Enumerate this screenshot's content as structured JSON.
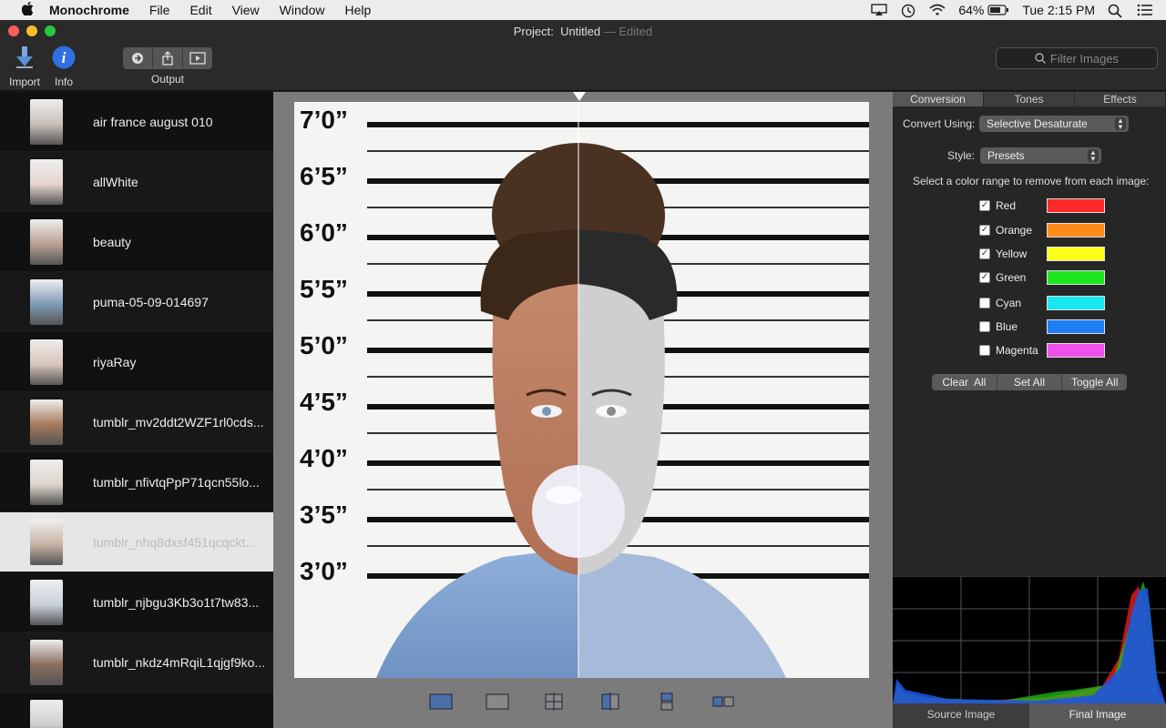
{
  "menubar": {
    "app_name": "Monochrome",
    "items": [
      "File",
      "Edit",
      "View",
      "Window",
      "Help"
    ],
    "battery": "64%",
    "clock": "Tue 2:15 PM"
  },
  "window": {
    "title_prefix": "Project:",
    "title_name": "Untitled",
    "title_suffix": "— Edited"
  },
  "toolbar": {
    "import_label": "Import",
    "info_label": "Info",
    "output_label": "Output",
    "filter_placeholder": "Filter Images"
  },
  "images": [
    {
      "name": "air france august 010",
      "thumb": "#c9bfb8"
    },
    {
      "name": "allWhite",
      "thumb": "#e6d3cf"
    },
    {
      "name": "beauty",
      "thumb": "#b89f90"
    },
    {
      "name": "puma-05-09-014697",
      "thumb": "#7e9bb8"
    },
    {
      "name": "riyaRay",
      "thumb": "#d8c5b8"
    },
    {
      "name": "tumblr_mv2ddt2WZF1rl0cds...",
      "thumb": "#a87a5a"
    },
    {
      "name": "tumblr_nfivtqPpP71qcn55lo...",
      "thumb": "#ddd5cc"
    },
    {
      "name": "tumblr_nhq8dxsf451qcqckt...",
      "thumb": "#c7b3a4"
    },
    {
      "name": "tumblr_njbgu3Kb3o1t7tw83...",
      "thumb": "#c9d0da"
    },
    {
      "name": "tumblr_nkdz4mRqiL1qjgf9ko...",
      "thumb": "#8b6f5e"
    },
    {
      "name": "",
      "thumb": "#cfcfcf"
    }
  ],
  "selected_index": 7,
  "photo": {
    "height_marks": [
      "7’0”",
      "6’5”",
      "6’0”",
      "5’5”",
      "5’0”",
      "4’5”",
      "4’0”",
      "3’5”",
      "3’0”"
    ]
  },
  "inspector": {
    "tabs": [
      "Conversion",
      "Tones",
      "Effects"
    ],
    "active_tab": "Conversion",
    "convert_using_label": "Convert Using:",
    "convert_using_value": "Selective Desaturate",
    "style_label": "Style:",
    "style_value": "Presets",
    "instruction": "Select a color range to remove from each image:",
    "colors": [
      {
        "label": "Red",
        "checked": true,
        "hex": "#ff2a2a"
      },
      {
        "label": "Orange",
        "checked": true,
        "hex": "#ff8c1a"
      },
      {
        "label": "Yellow",
        "checked": true,
        "hex": "#ffff1a"
      },
      {
        "label": "Green",
        "checked": true,
        "hex": "#1ee61e"
      },
      {
        "label": "Cyan",
        "checked": false,
        "hex": "#1ae8f0"
      },
      {
        "label": "Blue",
        "checked": false,
        "hex": "#1e7ff5"
      },
      {
        "label": "Magenta",
        "checked": false,
        "hex": "#f050ea"
      }
    ],
    "buttons": [
      "Clear  All",
      "Set All",
      "Toggle All"
    ]
  },
  "histogram": {
    "tabs": [
      "Source Image",
      "Final Image"
    ],
    "active_tab": "Final Image"
  }
}
